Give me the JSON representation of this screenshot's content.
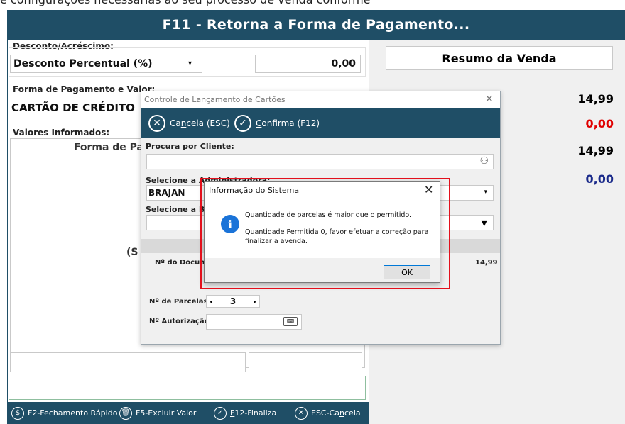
{
  "top_strip_text": "e configurações necessárias ao seu processo de venda conforme",
  "window": {
    "title": "F11 - Retorna a Forma de Pagamento..."
  },
  "desconto": {
    "label": "Desconto/Acréscimo:",
    "type_value": "Desconto Percentual (%)",
    "amount": "0,00"
  },
  "pagamento": {
    "label": "Forma de Pagamento e Valor:",
    "value": "CARTÃO DE CRÉDITO"
  },
  "valores": {
    "label": "Valores Informados:",
    "column_header": "Forma de Pa",
    "partial_text": "(S"
  },
  "resumo": {
    "title": "Resumo da Venda",
    "values": [
      {
        "text": "14,99",
        "color": "#111111"
      },
      {
        "text": "0,00",
        "color": "#e00000"
      },
      {
        "text": "14,99",
        "color": "#111111"
      },
      {
        "text": "0,00",
        "color": "#1a2a8a"
      }
    ]
  },
  "modal": {
    "title": "Controle de Lançamento de Cartões",
    "cancel": {
      "pre": "Ca",
      "underlined": "n",
      "post": "cela (ESC)"
    },
    "confirm": {
      "underlined": "C",
      "post": "onfirma (F12)"
    },
    "cliente_label": "Procura por Cliente:",
    "admin_label": "Selecione a Administradora:",
    "admin_value": "BRAJAN",
    "bandeira_label": "Selecione a Ba",
    "doc_label": "Nº do Docum",
    "doc_value": "14,99",
    "parcelas_label": "Nº de Parcelas:",
    "parcelas_value": "3",
    "autorizacao_label": "Nº Autorização:"
  },
  "dialog": {
    "title": "Informação do Sistema",
    "message_line1": "Quantidade de parcelas é maior que o permitido.",
    "message_line2": "Quantidade Permitida  0, favor efetuar a correção para",
    "message_line3": "finalizar a avenda.",
    "ok_label": "OK"
  },
  "bottom": {
    "f2": "F2-Fechamento Rápido",
    "f5": "F5-Excluir Valor",
    "f12_u": "F",
    "f12_rest": "12-Finaliza",
    "esc_pre": "ESC-Ca",
    "esc_u": "n",
    "esc_post": "cela"
  },
  "colors": {
    "accent": "#1f4e66",
    "highlight": "#e3101c",
    "info": "#1a73d8"
  }
}
